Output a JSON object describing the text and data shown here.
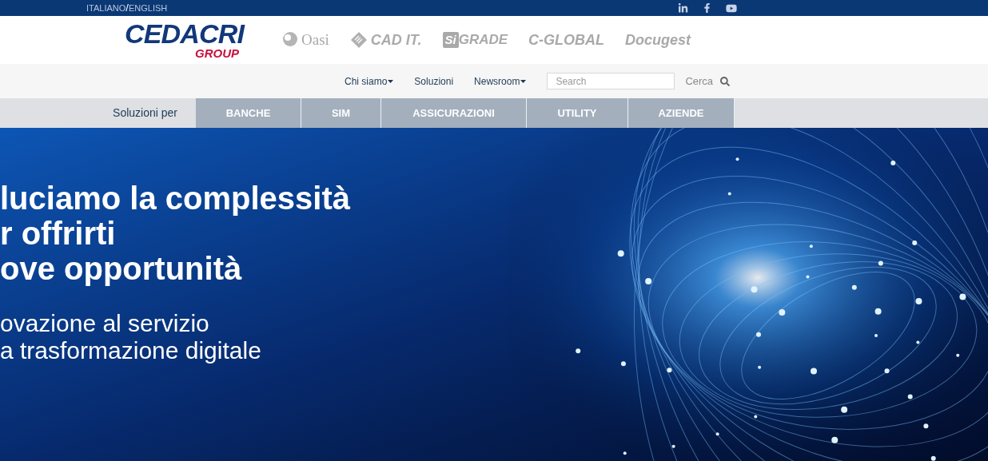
{
  "top_bar": {
    "languages": [
      "ITALIANO",
      "ENGLISH"
    ],
    "separator": "/"
  },
  "header": {
    "logo": {
      "name": "CEDACRI",
      "sub": "GROUP"
    },
    "partners": [
      {
        "kind": "oasi",
        "text": "Oasi"
      },
      {
        "kind": "cadit",
        "text": "CAD IT."
      },
      {
        "kind": "sigrade",
        "badge": "Si",
        "text": "GRADE"
      },
      {
        "kind": "plain",
        "text": "C-GLOBAL"
      },
      {
        "kind": "plain",
        "text": "**Docu**gest"
      }
    ]
  },
  "nav": {
    "items": [
      {
        "label": "Chi siamo",
        "dropdown": true
      },
      {
        "label": "Soluzioni",
        "dropdown": false
      },
      {
        "label": "Newsroom",
        "dropdown": true
      }
    ],
    "search": {
      "placeholder": "Search"
    },
    "search_button": "Cerca"
  },
  "solutions_bar": {
    "label": "Soluzioni per",
    "tabs": [
      "BANCHE",
      "SIM",
      "ASSICURAZIONI",
      "UTILITY",
      "AZIENDE"
    ]
  },
  "hero": {
    "headline": [
      "luciamo la complessità",
      "r offrirti",
      "ove opportunità"
    ],
    "subline": [
      "ovazione al servizio",
      "a trasformazione digitale"
    ]
  }
}
